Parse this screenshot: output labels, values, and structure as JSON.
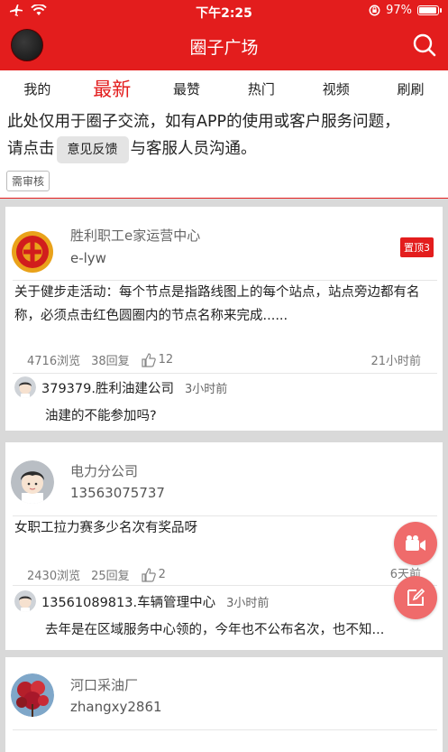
{
  "status_bar": {
    "time": "下午2:25",
    "battery": "97%",
    "battery_level": 0.97
  },
  "nav": {
    "title": "圈子广场"
  },
  "tabs": [
    {
      "label": "我的"
    },
    {
      "label": "最新",
      "active": true
    },
    {
      "label": "最赞"
    },
    {
      "label": "热门"
    },
    {
      "label": "视频"
    },
    {
      "label": "刷刷"
    }
  ],
  "notice": {
    "line1": "此处仅用于圈子交流，如有APP的使用或客户服务问题，",
    "line2_prefix": "请点击",
    "button": "意见反馈",
    "line2_suffix": "与客服人员沟通。",
    "review_badge": "需审核"
  },
  "colors": {
    "brand": "#e31d1d",
    "fab": "#ef6b6b"
  },
  "posts": [
    {
      "group": "胜利职工e家运营中心",
      "user": "e-lyw",
      "pin": "置顶3",
      "content": "关于健步走活动：每个节点是指路线图上的每个站点，站点旁边都有名称，必须点击红色圆圈内的节点名称来完成......",
      "views": "4716浏览",
      "replies": "38回复",
      "likes": "12",
      "time": "21小时前",
      "reply": {
        "name": "379379.胜利油建公司",
        "time": "3小时前",
        "text": "油建的不能参加吗?"
      }
    },
    {
      "group": "电力分公司",
      "user": "13563075737",
      "content": "女职工拉力赛多少名次有奖品呀",
      "views": "2430浏览",
      "replies": "25回复",
      "likes": "2",
      "time": "6天前",
      "reply": {
        "name": "13561089813.车辆管理中心",
        "time": "3小时前",
        "text": "去年是在区域服务中心领的，今年也不公布名次，也不知..."
      }
    },
    {
      "group": "河口采油厂",
      "user": "zhangxy2861"
    }
  ]
}
